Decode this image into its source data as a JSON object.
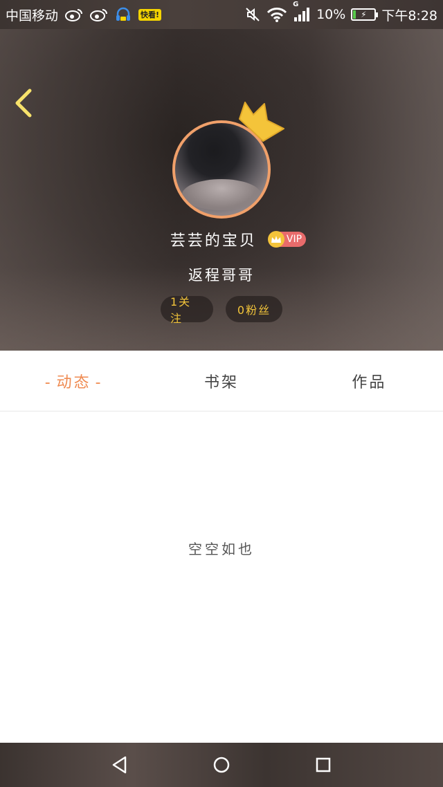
{
  "status_bar": {
    "carrier": "中国移动",
    "notification_icons": [
      "weibo-icon",
      "weibo-icon",
      "headset-icon",
      "kuaikan-icon"
    ],
    "kuaikan_label": "快看!",
    "network_type": "G",
    "battery_percent": "10%",
    "battery_level": 0.1,
    "time": "下午8:28"
  },
  "profile": {
    "name": "芸芸的宝贝",
    "vip_label": "VIP",
    "subtitle": "返程哥哥",
    "follow_count_label": "1关注",
    "fans_count_label": "0粉丝",
    "accent_color": "#ef8a50",
    "avatar_border_color": "#f0a06a",
    "stats_text_color": "#f2c43a"
  },
  "tabs": [
    {
      "label": "动态",
      "active": true
    },
    {
      "label": "书架",
      "active": false
    },
    {
      "label": "作品",
      "active": false
    }
  ],
  "empty_state": {
    "text": "空空如也"
  },
  "nav_bar": {
    "buttons": [
      "back-triangle-icon",
      "home-circle-icon",
      "recents-square-icon"
    ]
  }
}
